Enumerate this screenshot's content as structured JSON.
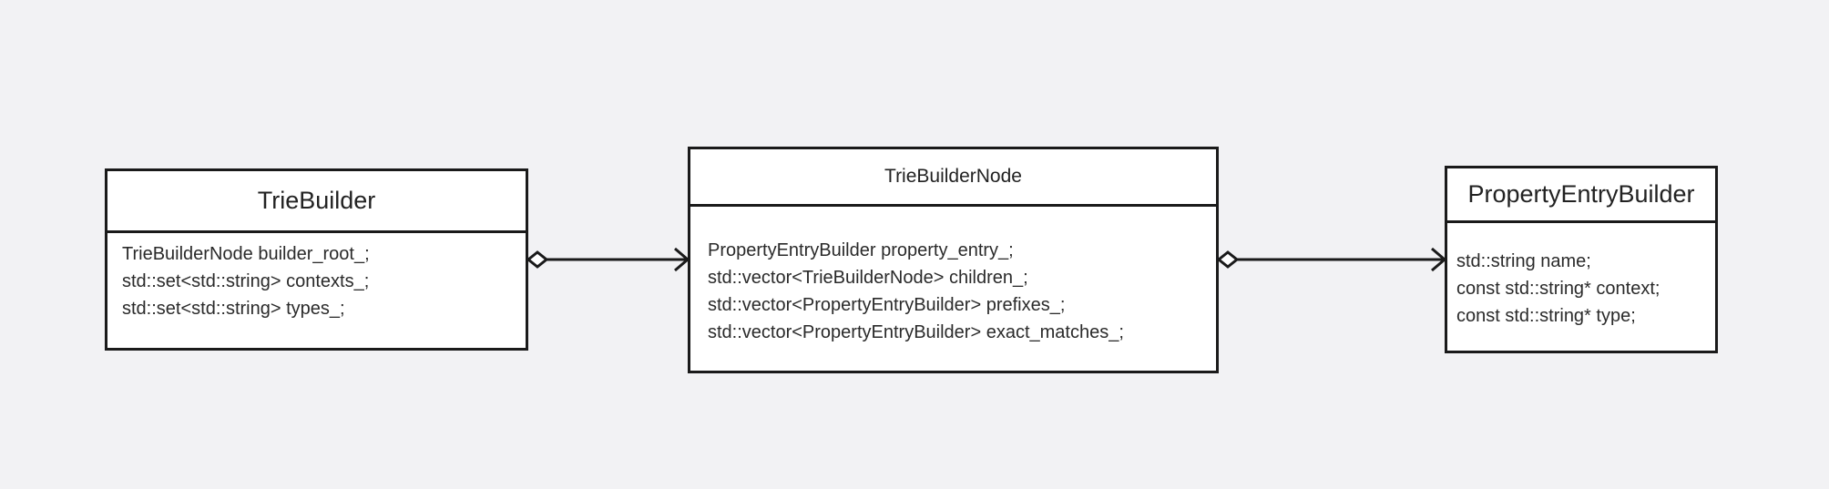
{
  "diagram": {
    "classes": [
      {
        "name": "TrieBuilder",
        "attributes": [
          "TrieBuilderNode builder_root_;",
          "std::set<std::string> contexts_;",
          "std::set<std::string> types_;"
        ]
      },
      {
        "name": "TrieBuilderNode",
        "attributes": [
          "PropertyEntryBuilder property_entry_;",
          "std::vector<TrieBuilderNode> children_;",
          "std::vector<PropertyEntryBuilder> prefixes_;",
          "std::vector<PropertyEntryBuilder> exact_matches_;"
        ]
      },
      {
        "name": "PropertyEntryBuilder",
        "attributes": [
          "std::string name;",
          "const std::string* context;",
          "const std::string* type;"
        ]
      }
    ],
    "relations": [
      {
        "from": "TrieBuilder",
        "to": "TrieBuilderNode",
        "type": "aggregation"
      },
      {
        "from": "TrieBuilderNode",
        "to": "PropertyEntryBuilder",
        "type": "aggregation"
      }
    ]
  },
  "colors": {
    "background": "#f2f2f4",
    "box_fill": "#ffffff",
    "stroke": "#1a1a1a"
  }
}
